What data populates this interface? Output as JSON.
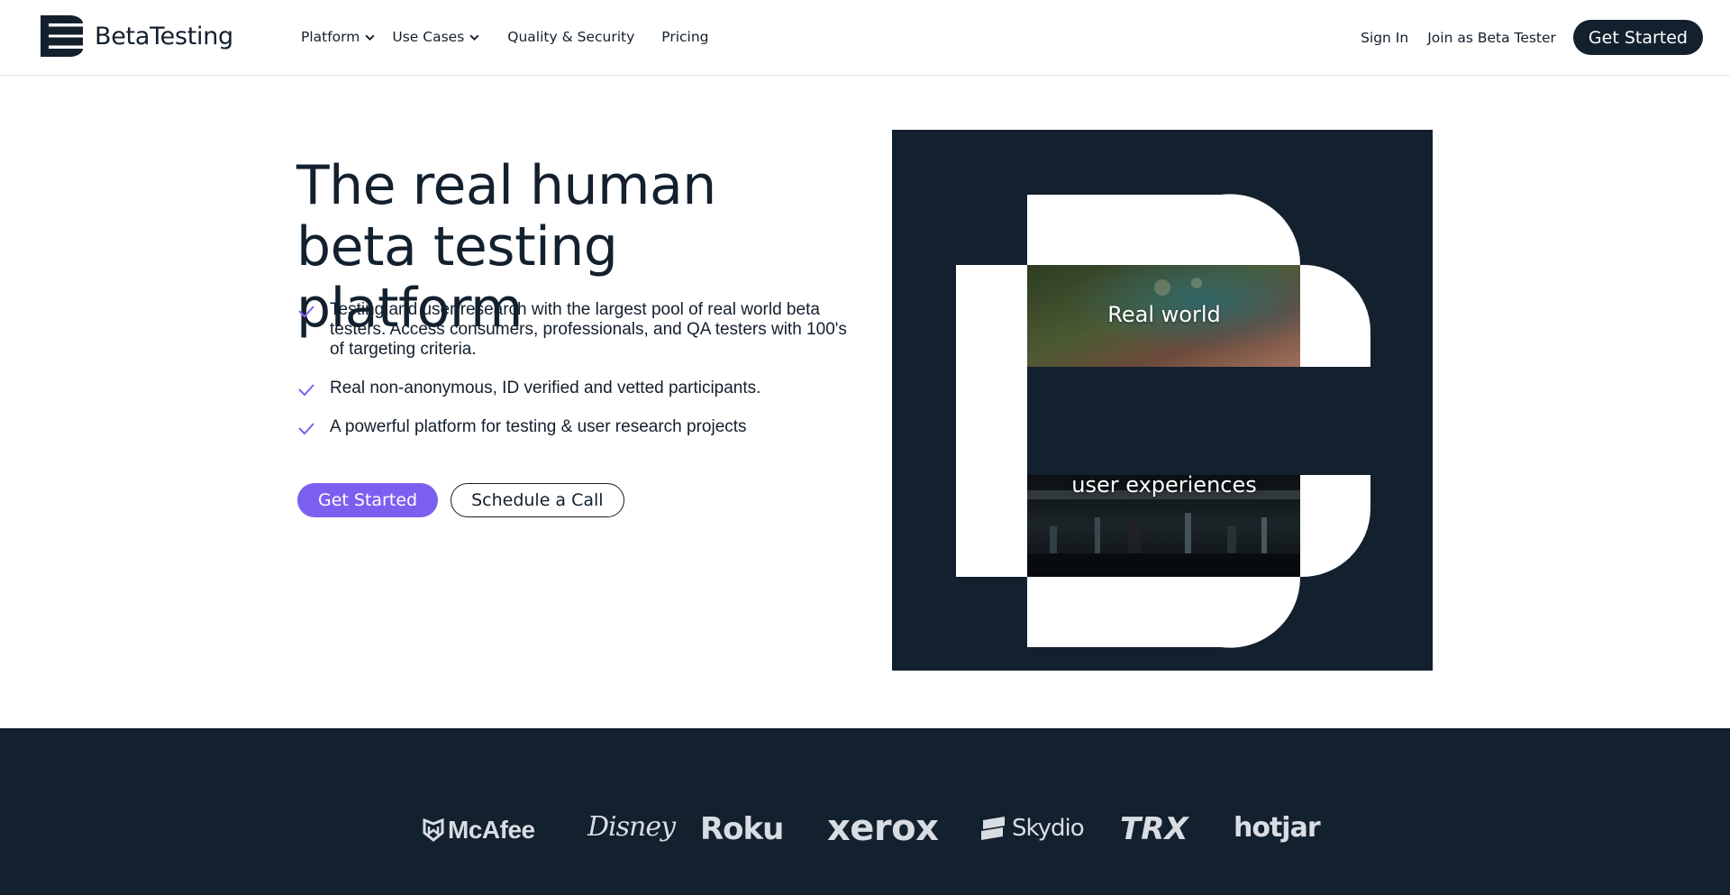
{
  "header": {
    "brand": "BetaTesting",
    "nav": [
      {
        "label": "Platform",
        "has_dropdown": true
      },
      {
        "label": "Use Cases",
        "has_dropdown": true
      },
      {
        "label": "Quality & Security",
        "has_dropdown": false
      },
      {
        "label": "Pricing",
        "has_dropdown": false
      }
    ],
    "sign_in": "Sign In",
    "join": "Join as Beta Tester",
    "get_started": "Get Started"
  },
  "hero": {
    "title": "The real human beta testing platform",
    "bullets": [
      "Testing and user research with the largest pool of real world beta testers. Access consumers, professionals, and QA testers with 100's of targeting criteria.",
      "Real non-anonymous, ID verified and vetted participants.",
      "A powerful platform for testing & user research projects"
    ],
    "primary_cta": "Get Started",
    "secondary_cta": "Schedule a Call",
    "graphic_labels": [
      "Real world",
      "user experiences"
    ]
  },
  "logos": [
    "McAfee",
    "Disney",
    "Roku",
    "xerox",
    "Skydio",
    "TRX",
    "hotjar"
  ],
  "colors": {
    "navy": "#13202e",
    "accent_purple": "#7d5ff0",
    "white": "#ffffff"
  }
}
